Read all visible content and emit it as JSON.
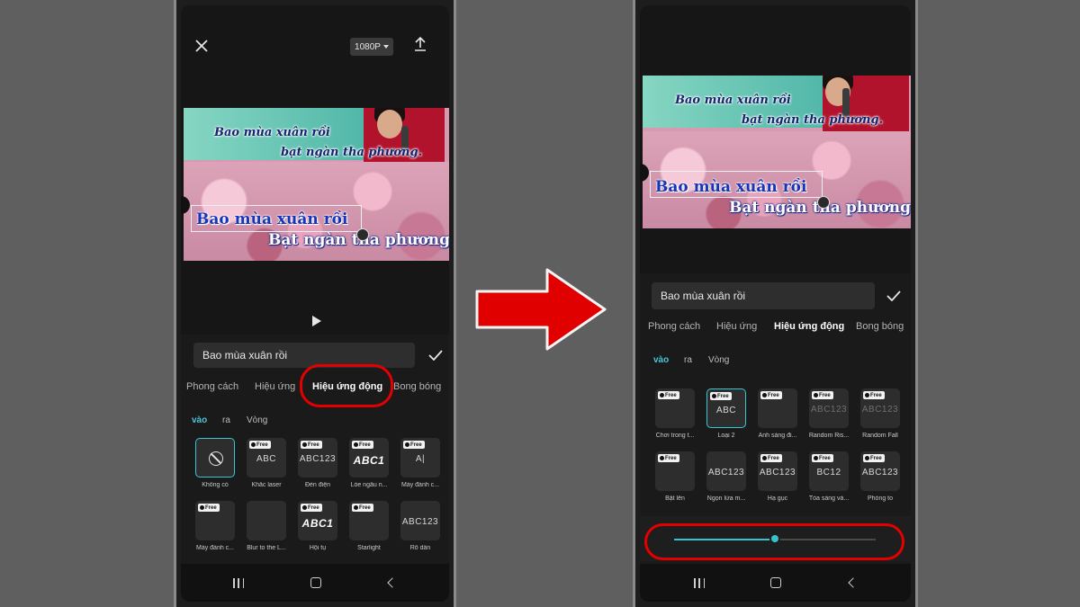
{
  "left": {
    "resolution": "1080P",
    "lyrics_top": [
      "Bao mùa xuân rồi",
      "bạt ngàn tha phương."
    ],
    "lyrics_main": [
      "Bao mùa xuân rồi",
      "Bạt ngàn tha phương"
    ],
    "text_value": "Bao mùa xuân rồi",
    "tabs": [
      "Phong cách",
      "Hiệu ứng",
      "Hiệu ứng động",
      "Bong bóng"
    ],
    "active_tab": "Hiệu ứng động",
    "subtabs": [
      "vào",
      "ra",
      "Vòng"
    ],
    "free_badge": "Free",
    "effects": [
      {
        "label": "Không có",
        "preview": "",
        "free": false,
        "selected": true
      },
      {
        "label": "Khắc laser",
        "preview": "ABC",
        "free": true
      },
      {
        "label": "Đèn điện",
        "preview": "ABC123",
        "free": true
      },
      {
        "label": "Lóe ngẫu n...",
        "preview": "ABC1",
        "free": true
      },
      {
        "label": "Máy đánh c...",
        "preview": "A|",
        "free": true
      },
      {
        "label": "Máy đánh c...",
        "preview": "",
        "free": true
      },
      {
        "label": "Blur to the L...",
        "preview": "",
        "free": false
      },
      {
        "label": "Hội tụ",
        "preview": "ABC1",
        "free": true
      },
      {
        "label": "Starlight",
        "preview": "",
        "free": true
      },
      {
        "label": "Rõ dần",
        "preview": "ABC123",
        "free": false
      }
    ]
  },
  "right": {
    "lyrics_top": [
      "Bao mùa xuân rồi",
      "bạt ngàn tha phương."
    ],
    "lyrics_main": [
      "Bao mùa xuân rồi",
      "Bạt ngàn tha phương"
    ],
    "text_value": "Bao mùa xuân rồi",
    "tabs": [
      "Phong cách",
      "Hiệu ứng",
      "Hiệu ứng động",
      "Bong bóng"
    ],
    "active_tab": "Hiệu ứng động",
    "subtabs": [
      "vào",
      "ra",
      "Vòng"
    ],
    "free_badge": "Free",
    "effects": [
      {
        "label": "Chơi trong t...",
        "preview": "",
        "free": true
      },
      {
        "label": "Loại 2",
        "preview": "ABC",
        "free": true,
        "selected": true
      },
      {
        "label": "Ánh sáng đi...",
        "preview": "",
        "free": true
      },
      {
        "label": "Random Ris...",
        "preview": "ABC123",
        "free": true,
        "dim": true
      },
      {
        "label": "Random Fall",
        "preview": "ABC123",
        "free": true,
        "dim": true
      },
      {
        "label": "Bật lên",
        "preview": "",
        "free": true
      },
      {
        "label": "Ngọn lửa m...",
        "preview": "ABC123",
        "free": false
      },
      {
        "label": "Hạ gục",
        "preview": "ABC123",
        "free": true
      },
      {
        "label": "Tỏa sáng và...",
        "preview": "BC12",
        "free": true
      },
      {
        "label": "Phóng to",
        "preview": "ABC123",
        "free": true
      }
    ],
    "duration_fraction": 0.5
  },
  "colors": {
    "accent": "#35c3cf",
    "highlight": "#e40000"
  }
}
